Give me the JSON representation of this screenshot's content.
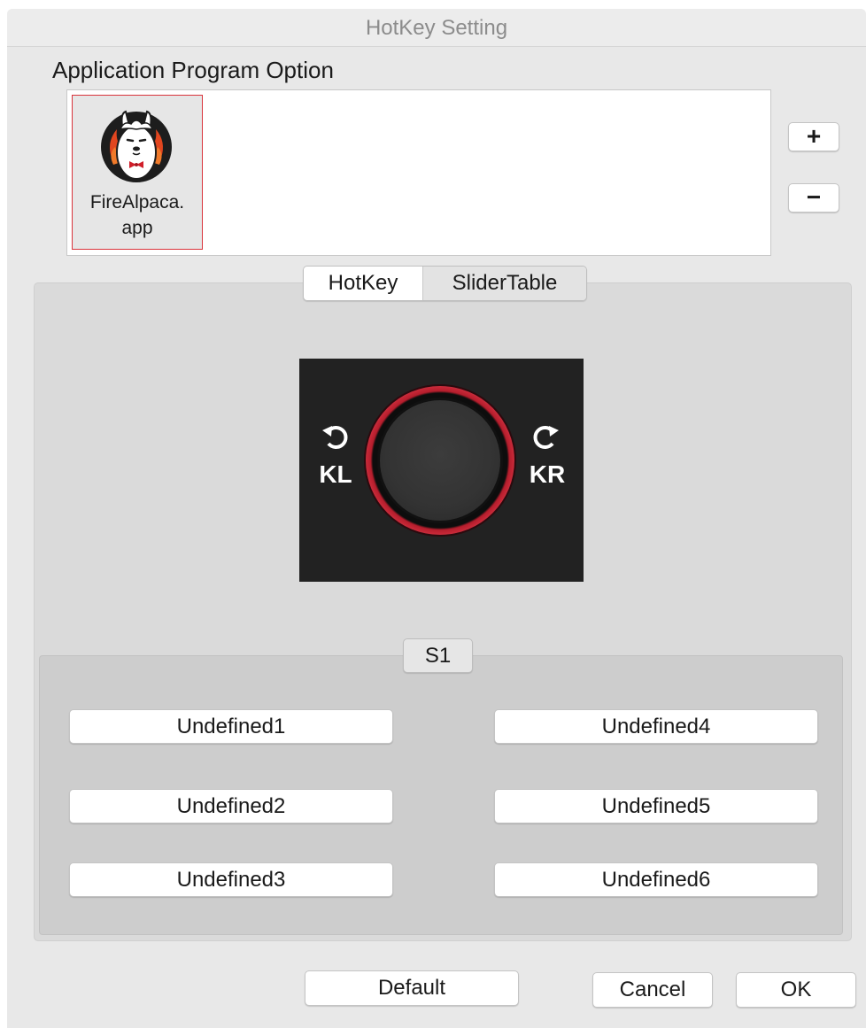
{
  "window": {
    "title": "HotKey Setting"
  },
  "app_option": {
    "label": "Application Program Option",
    "apps": [
      {
        "name_line1": "FireAlpaca.",
        "name_line2": "app",
        "icon": "firealpaca-app-icon",
        "selected": true
      }
    ],
    "add_label": "+",
    "remove_label": "−"
  },
  "tabs": {
    "items": [
      {
        "label": "HotKey",
        "active": true
      },
      {
        "label": "SliderTable",
        "active": false
      }
    ]
  },
  "device": {
    "left_label": "KL",
    "right_label": "KR",
    "left_icon": "rotate-counterclockwise-icon",
    "right_icon": "rotate-clockwise-icon"
  },
  "slider_group": {
    "label": "S1",
    "keys": [
      "Undefined1",
      "Undefined2",
      "Undefined3",
      "Undefined4",
      "Undefined5",
      "Undefined6"
    ]
  },
  "footer": {
    "default_label": "Default",
    "cancel_label": "Cancel",
    "ok_label": "OK"
  },
  "colors": {
    "selection_border": "#d9333b",
    "dial_ring": "#c8283a",
    "device_bg": "#222222"
  }
}
